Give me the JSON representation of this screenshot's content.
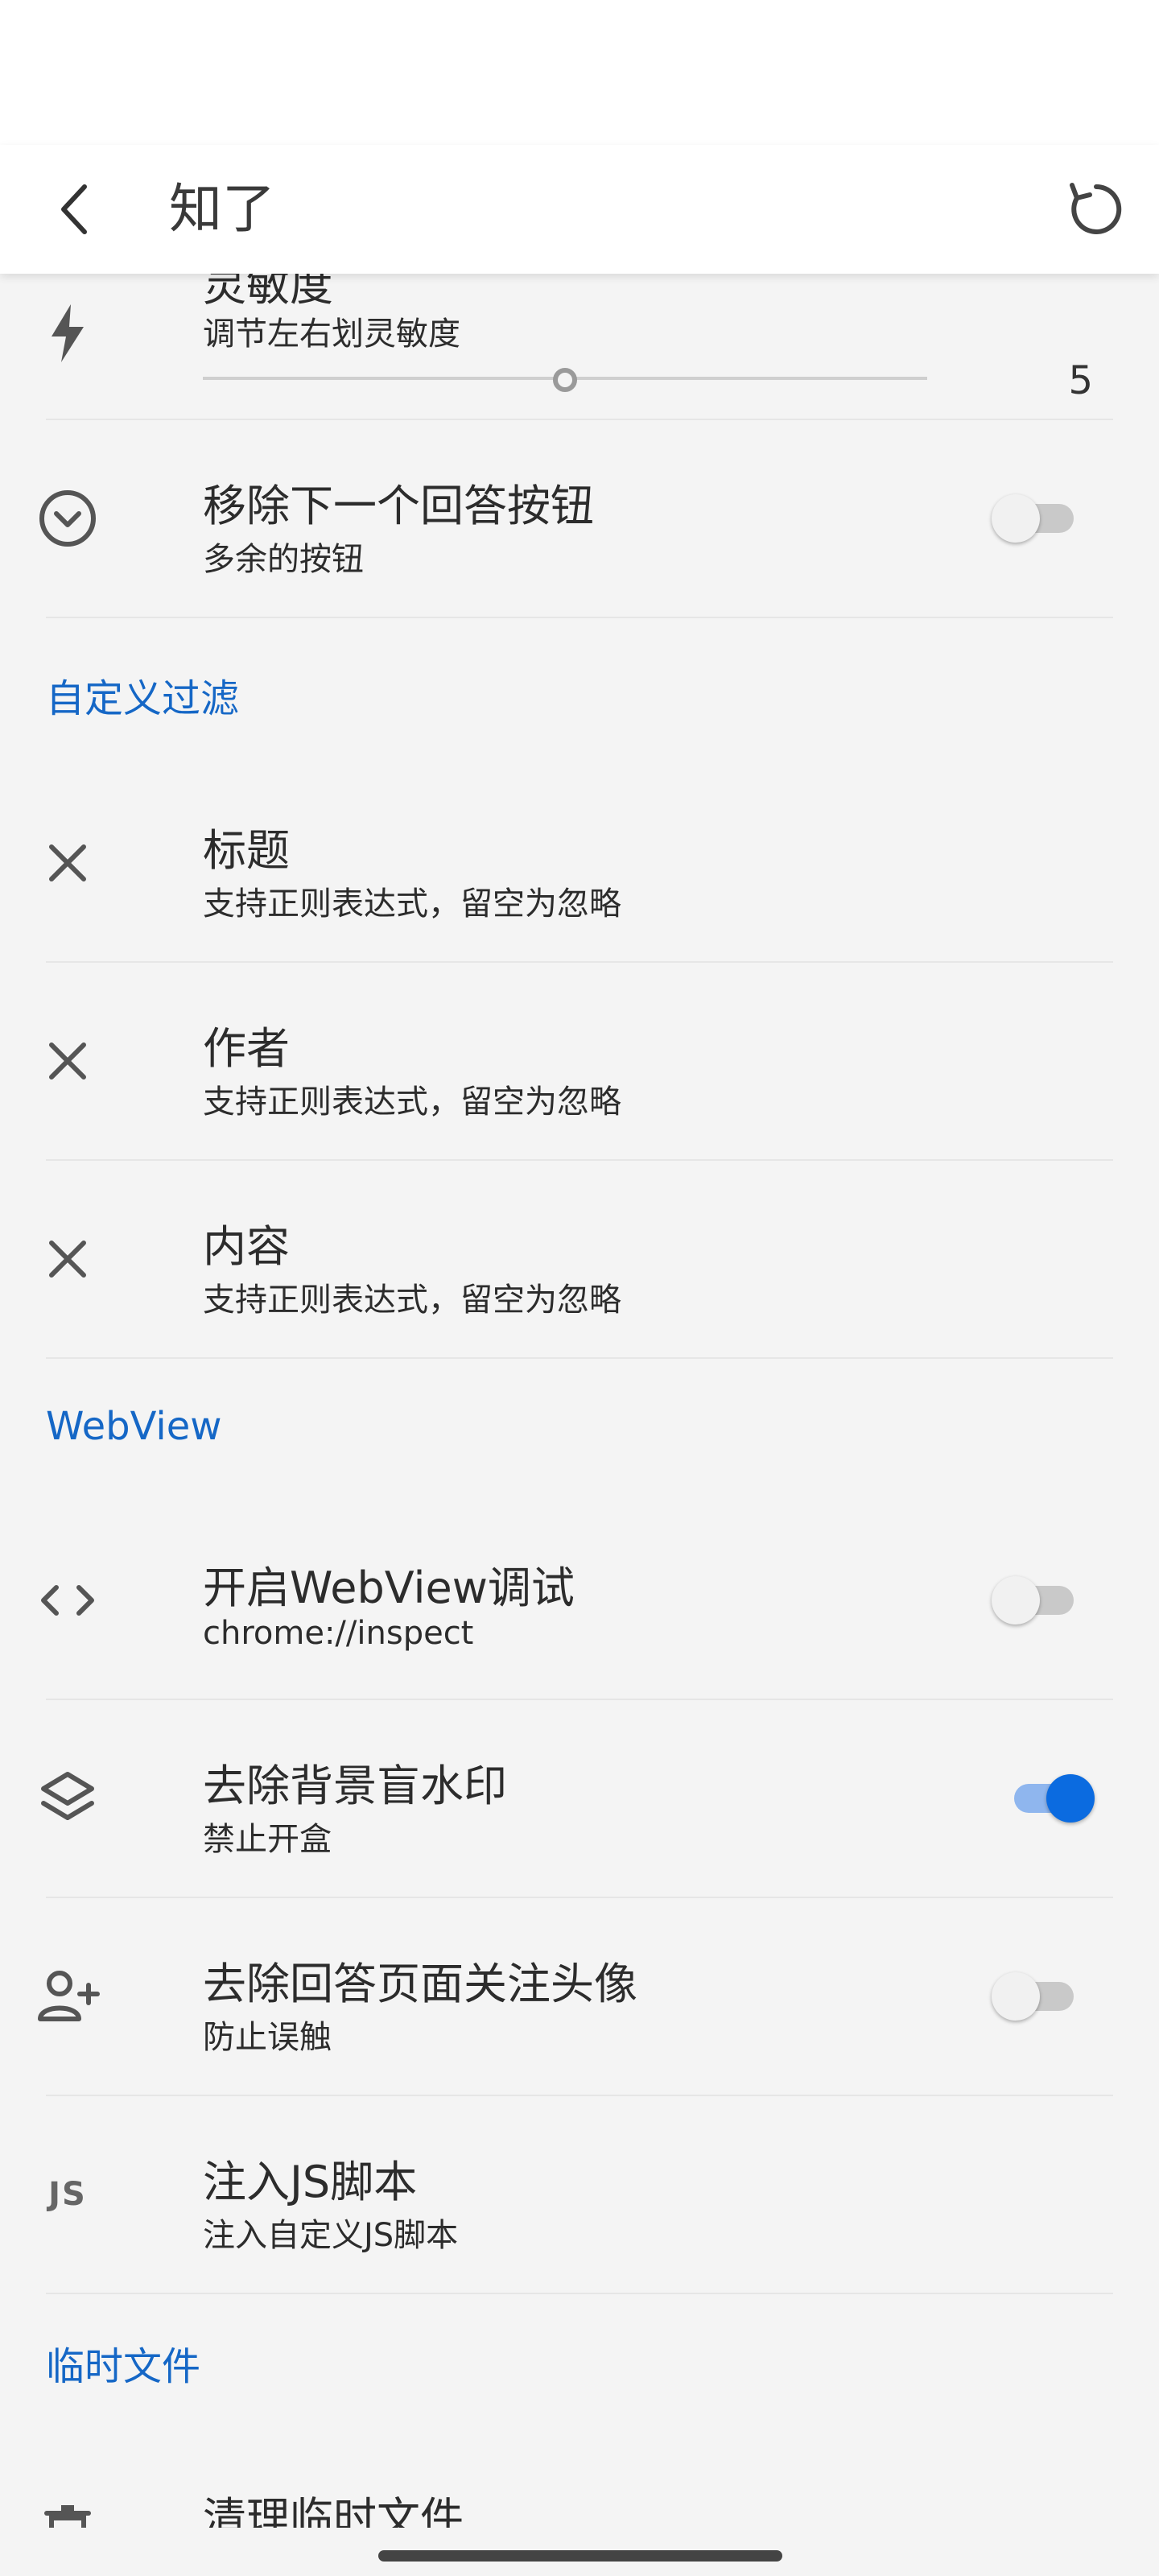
{
  "app_bar": {
    "title": "知了",
    "back_icon": "arrow-back-icon",
    "reset_icon": "reset-icon"
  },
  "sensitivity": {
    "title": "灵敏度",
    "subtitle": "调节左右划灵敏度",
    "value": "5",
    "slider_fraction": 0.5,
    "icon": "lightning-icon"
  },
  "remove_next_answer": {
    "title": "移除下一个回答按钮",
    "subtitle": "多余的按钮",
    "enabled": false,
    "icon": "chevron-circle-icon"
  },
  "section_custom_filter": "自定义过滤",
  "filters": [
    {
      "title": "标题",
      "subtitle": "支持正则表达式，留空为忽略",
      "icon": "close-icon"
    },
    {
      "title": "作者",
      "subtitle": "支持正则表达式，留空为忽略",
      "icon": "close-icon"
    },
    {
      "title": "内容",
      "subtitle": "支持正则表达式，留空为忽略",
      "icon": "close-icon"
    }
  ],
  "section_webview": "WebView",
  "webview_debug": {
    "title": "开启WebView调试",
    "subtitle": "chrome://inspect",
    "enabled": false,
    "icon": "code-icon"
  },
  "remove_watermark": {
    "title": "去除背景盲水印",
    "subtitle": "禁止开盒",
    "enabled": true,
    "icon": "layers-icon"
  },
  "remove_follow_avatar": {
    "title": "去除回答页面关注头像",
    "subtitle": "防止误触",
    "enabled": false,
    "icon": "person-add-icon"
  },
  "inject_js": {
    "title": "注入JS脚本",
    "subtitle": "注入自定义JS脚本",
    "icon_label": "JS",
    "icon": "js-icon"
  },
  "section_temp_files": "临时文件",
  "clear_temp": {
    "title": "清理临时文件",
    "icon": "trash-icon"
  },
  "colors": {
    "accent": "#0b6be0",
    "section_text": "#1567c6",
    "background": "#f4f4f4"
  }
}
